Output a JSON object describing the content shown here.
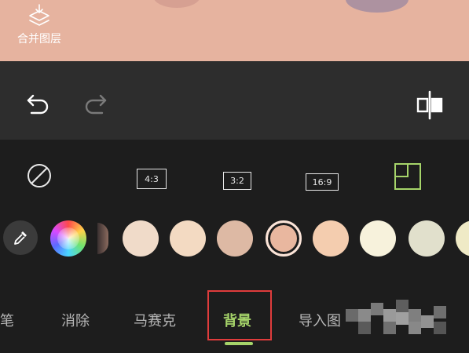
{
  "canvas": {
    "merge_layers_label": "合并图层",
    "merge_layers_icon": "merge-layers-icon"
  },
  "toolbar": {
    "undo_icon": "undo-icon",
    "redo_icon": "redo-icon",
    "mirror_icon": "flip-mirror-icon"
  },
  "ratio_options": [
    {
      "icon": "no-ratio-icon",
      "label": ""
    },
    {
      "icon": "ratio-icon",
      "label": "4:3"
    },
    {
      "icon": "ratio-icon",
      "label": "3:2"
    },
    {
      "icon": "ratio-icon",
      "label": "16:9"
    },
    {
      "icon": "crop-custom-icon",
      "label": ""
    }
  ],
  "colors": {
    "eyedropper_icon": "eyedropper-icon",
    "color_wheel_icon": "color-wheel-icon",
    "swatches": [
      "#f0dbc9",
      "#f3dac2",
      "#ddb9a4",
      "#e9b79f",
      "#f4cdaf",
      "#f7f2dc",
      "#e1e0cc",
      "#efeac6"
    ],
    "selected_index": 3
  },
  "tabs": [
    {
      "label": "笔"
    },
    {
      "label": "消除"
    },
    {
      "label": "马赛克"
    },
    {
      "label": "背景"
    },
    {
      "label": "导入图"
    }
  ],
  "active_tab_index": 3,
  "accent_color": "#a6d46a",
  "highlight_color": "#e03c3c"
}
